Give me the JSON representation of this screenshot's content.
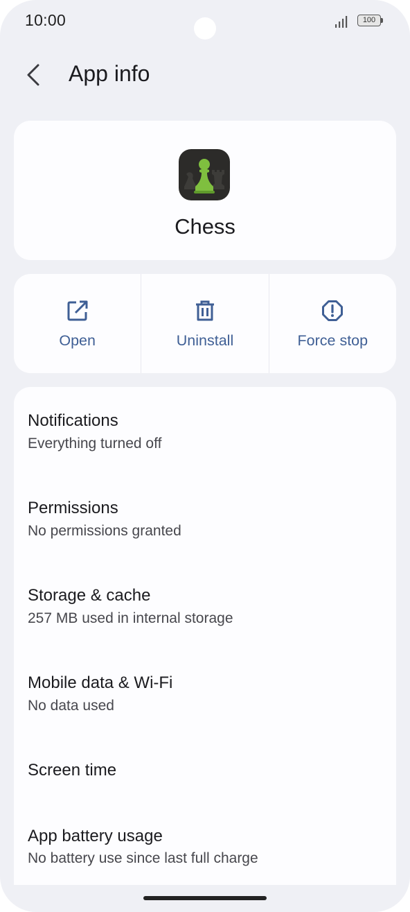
{
  "status_bar": {
    "time": "10:00",
    "battery": "100"
  },
  "header": {
    "back_icon": "arrow-back-icon",
    "title": "App info"
  },
  "app": {
    "name": "Chess",
    "icon": "chess-pawn-icon"
  },
  "actions": [
    {
      "label": "Open",
      "icon": "open-external-icon"
    },
    {
      "label": "Uninstall",
      "icon": "trash-icon"
    },
    {
      "label": "Force stop",
      "icon": "alert-octagon-icon"
    }
  ],
  "settings": [
    {
      "title": "Notifications",
      "subtitle": "Everything turned off"
    },
    {
      "title": "Permissions",
      "subtitle": "No permissions granted"
    },
    {
      "title": "Storage & cache",
      "subtitle": "257 MB used in internal storage"
    },
    {
      "title": "Mobile data & Wi-Fi",
      "subtitle": "No data used"
    },
    {
      "title": "Screen time",
      "subtitle": ""
    },
    {
      "title": "App battery usage",
      "subtitle": "No battery use since last full charge"
    }
  ],
  "colors": {
    "background": "#eff0f5",
    "card": "#fdfdff",
    "accent": "#3f5f95",
    "chess_green": "#7fbf3f"
  }
}
